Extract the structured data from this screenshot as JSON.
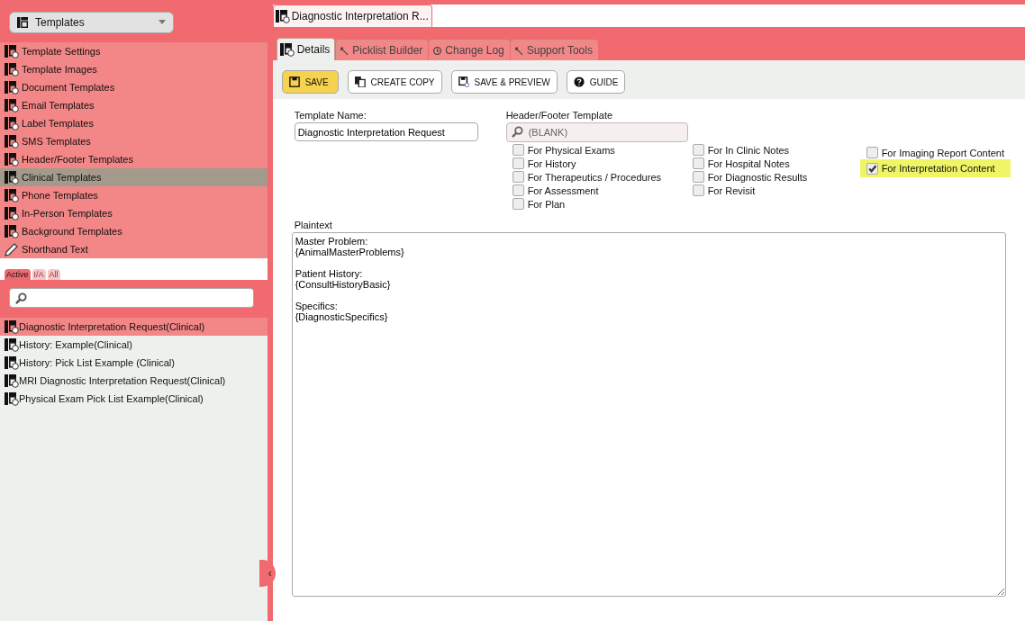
{
  "module_select": {
    "label": "Templates"
  },
  "menu": [
    {
      "label": "Template Settings",
      "kind": "template",
      "selected": false
    },
    {
      "label": "Template Images",
      "kind": "template",
      "selected": false
    },
    {
      "label": "Document Templates",
      "kind": "template",
      "selected": false
    },
    {
      "label": "Email Templates",
      "kind": "template",
      "selected": false
    },
    {
      "label": "Label Templates",
      "kind": "template",
      "selected": false
    },
    {
      "label": "SMS Templates",
      "kind": "template",
      "selected": false
    },
    {
      "label": "Header/Footer Templates",
      "kind": "template",
      "selected": false
    },
    {
      "label": "Clinical Templates",
      "kind": "template",
      "selected": true
    },
    {
      "label": "Phone Templates",
      "kind": "template",
      "selected": false
    },
    {
      "label": "In-Person Templates",
      "kind": "template",
      "selected": false
    },
    {
      "label": "Background Templates",
      "kind": "template",
      "selected": false
    },
    {
      "label": "Shorthand Text",
      "kind": "pencil",
      "selected": false
    }
  ],
  "filter_tabs": [
    {
      "label": "Active",
      "selected": true
    },
    {
      "label": "I/A",
      "selected": false
    },
    {
      "label": "All",
      "selected": false
    }
  ],
  "templates": [
    {
      "label": "Diagnostic Interpretation Request(Clinical)",
      "selected": true
    },
    {
      "label": "History: Example(Clinical)",
      "selected": false
    },
    {
      "label": "History: Pick List Example (Clinical)",
      "selected": false
    },
    {
      "label": "MRI Diagnostic Interpretation Request(Clinical)",
      "selected": false
    },
    {
      "label": "Physical Exam Pick List Example(Clinical)",
      "selected": false
    }
  ],
  "collapse_glyph": "‹",
  "document_tab": {
    "title": "Diagnostic Interpretation R..."
  },
  "tabs": [
    {
      "label": "Details",
      "kind": "template",
      "selected": true
    },
    {
      "label": "Picklist Builder",
      "kind": "wrench",
      "selected": false
    },
    {
      "label": "Change Log",
      "kind": "history",
      "selected": false
    },
    {
      "label": "Support Tools",
      "kind": "wrench",
      "selected": false
    }
  ],
  "buttons": [
    {
      "label": "SAVE",
      "kind": "save",
      "primary": true
    },
    {
      "label": "CREATE COPY",
      "kind": "copy",
      "primary": false
    },
    {
      "label": "SAVE & PREVIEW",
      "kind": "preview",
      "primary": false
    },
    {
      "label": "GUIDE",
      "kind": "guide",
      "primary": false
    }
  ],
  "template_name": {
    "label": "Template Name:",
    "value": "Diagnostic Interpretation Request"
  },
  "header_footer": {
    "label": "Header/Footer Template",
    "placeholder": "(BLANK)"
  },
  "flag_columns": [
    [
      {
        "label": "For Physical Exams",
        "checked": false,
        "highlighted": false
      },
      {
        "label": "For History",
        "checked": false,
        "highlighted": false
      },
      {
        "label": "For Therapeutics / Procedures",
        "checked": false,
        "highlighted": false
      },
      {
        "label": "For Assessment",
        "checked": false,
        "highlighted": false
      },
      {
        "label": "For Plan",
        "checked": false,
        "highlighted": false
      }
    ],
    [
      {
        "label": "For In Clinic Notes",
        "checked": false,
        "highlighted": false
      },
      {
        "label": "For Hospital Notes",
        "checked": false,
        "highlighted": false
      },
      {
        "label": "For Diagnostic Results",
        "checked": false,
        "highlighted": false
      },
      {
        "label": "For Revisit",
        "checked": false,
        "highlighted": false
      }
    ],
    [
      {
        "label": "For Imaging Report Content",
        "checked": false,
        "highlighted": false
      },
      {
        "label": "For Interpretation Content",
        "checked": true,
        "highlighted": true
      }
    ]
  ],
  "plaintext": {
    "label": "Plaintext",
    "value": "Master Problem:\n{AnimalMasterProblems}\n\nPatient History:\n{ConsultHistoryBasic}\n\nSpecifics:\n{DiagnosticSpecifics}"
  }
}
